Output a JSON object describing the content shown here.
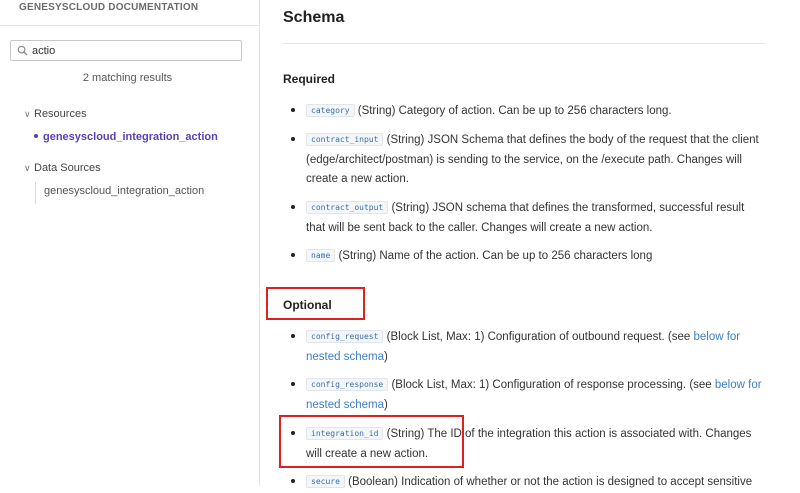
{
  "sidebar": {
    "brand": "GENESYSCLOUD DOCUMENTATION",
    "search": {
      "value": "actio"
    },
    "match_count": "2 matching results",
    "groups": [
      {
        "label": "Resources",
        "items": [
          "genesyscloud_integration_action"
        ]
      },
      {
        "label": "Data Sources",
        "items": [
          "genesyscloud_integration_action"
        ]
      }
    ]
  },
  "main": {
    "title": "Schema",
    "required_heading": "Required",
    "optional_heading": "Optional",
    "required": [
      {
        "code": "category",
        "text": "(String) Category of action. Can be up to 256 characters long."
      },
      {
        "code": "contract_input",
        "text": "(String) JSON Schema that defines the body of the request that the client (edge/architect/postman) is sending to the service, on the /execute path. Changes will create a new action."
      },
      {
        "code": "contract_output",
        "text": "(String) JSON schema that defines the transformed, successful result that will be sent back to the caller. Changes will create a new action."
      },
      {
        "code": "name",
        "text": "(String) Name of the action. Can be up to 256 characters long"
      }
    ],
    "optional": [
      {
        "code": "config_request",
        "text": "(Block List, Max: 1) Configuration of outbound request. (see ",
        "link": "below for nested schema",
        "tail": ")"
      },
      {
        "code": "config_response",
        "text": "(Block List, Max: 1) Configuration of response processing. (see ",
        "link": "below for nested schema",
        "tail": ")"
      },
      {
        "code": "integration_id",
        "text": "(String) The ID of the integration this action is associated with. Changes will create a new action."
      },
      {
        "code": "secure",
        "text": "(Boolean) Indication of whether or not the action is designed to accept sensitive"
      }
    ]
  },
  "colors": {
    "highlight": "#e02020",
    "active": "#5b3fb4",
    "link": "#3d7cc9"
  }
}
